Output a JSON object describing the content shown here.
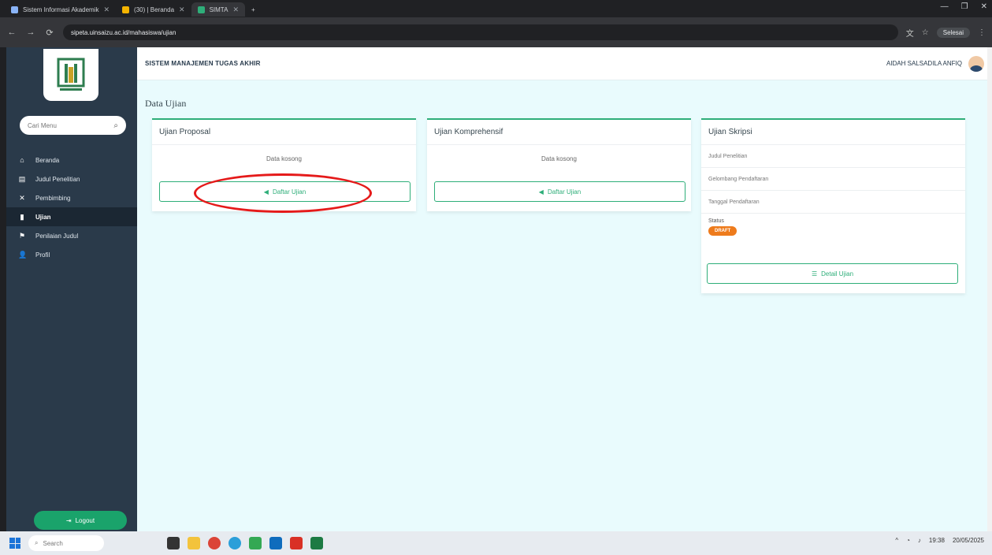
{
  "browser": {
    "tabs": [
      {
        "label": "Sistem Informasi Akademik",
        "active": false
      },
      {
        "label": "(30) | Beranda",
        "active": false
      },
      {
        "label": "SIMTA",
        "active": true
      }
    ],
    "new_tab_symbol": "+",
    "address": "sipeta.uinsaizu.ac.id/mahasiswa/ujian",
    "profile_label": "Selesai"
  },
  "sidebar": {
    "search_placeholder": "Cari Menu",
    "items": [
      {
        "label": "Beranda",
        "icon": "home-icon",
        "active": false
      },
      {
        "label": "Judul Penelitian",
        "icon": "document-icon",
        "active": false
      },
      {
        "label": "Pembimbing",
        "icon": "close-icon",
        "active": false
      },
      {
        "label": "Ujian",
        "icon": "file-icon",
        "active": true
      },
      {
        "label": "Penilaian Judul",
        "icon": "flag-icon",
        "active": false
      },
      {
        "label": "Profil",
        "icon": "user-icon",
        "active": false
      }
    ],
    "logout_label": "Logout"
  },
  "header": {
    "app_title": "SISTEM MANAJEMEN TUGAS AKHIR",
    "user_name": "AIDAH SALSADILA ANFIQ"
  },
  "page": {
    "title": "Data Ujian",
    "cards": {
      "proposal": {
        "title": "Ujian Proposal",
        "empty_text": "Data kosong",
        "button_label": "Daftar Ujian"
      },
      "komprehensif": {
        "title": "Ujian Komprehensif",
        "empty_text": "Data kosong",
        "button_label": "Daftar Ujian"
      },
      "skripsi": {
        "title": "Ujian Skripsi",
        "rows": [
          "Judul Penelitian",
          "Gelombang Pendaftaran",
          "Tanggal Pendaftaran"
        ],
        "status_label": "Status",
        "status_value": "DRAFT",
        "button_label": "Detail Ujian"
      }
    }
  },
  "taskbar": {
    "search_label": "Search",
    "time": "19:38",
    "date": "20/05/2025"
  },
  "colors": {
    "accent_green": "#2eae79",
    "sidebar_bg": "#2a3a4a",
    "main_bg": "#e9fbfd",
    "badge_orange": "#ee7b1c",
    "annotation_red": "#e51a1a"
  }
}
